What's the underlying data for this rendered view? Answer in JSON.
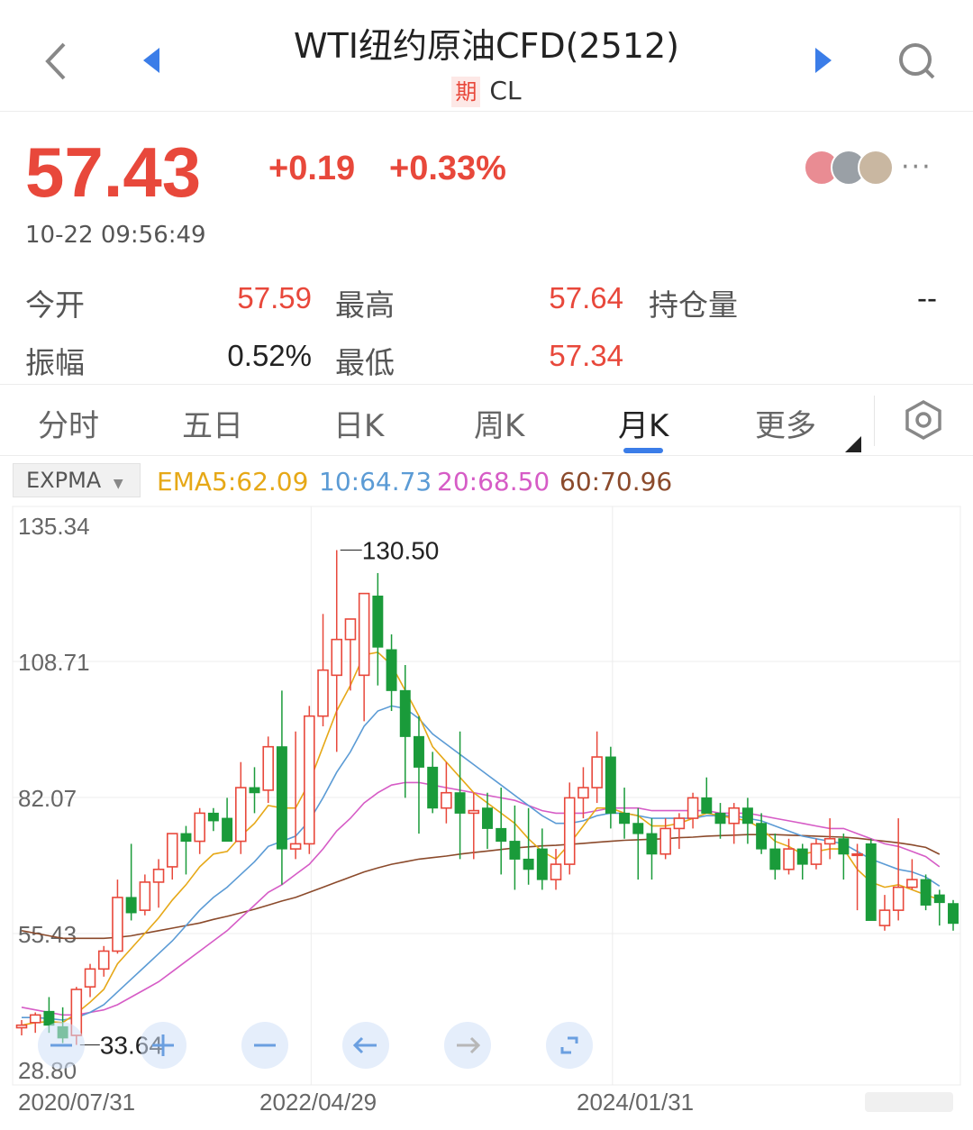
{
  "header": {
    "title": "WTI纽约原油CFD(2512)",
    "badge": "期",
    "symbol": "CL",
    "icons": [
      "back-icon",
      "prev-triangle-icon",
      "next-triangle-icon",
      "search-icon"
    ]
  },
  "quote": {
    "price": "57.43",
    "change": "+0.19",
    "change_pct": "+0.33%",
    "time": "10-22 09:56:49",
    "more": "···"
  },
  "stats": {
    "open_label": "今开",
    "open": "57.59",
    "high_label": "最高",
    "high": "57.64",
    "oi_label": "持仓量",
    "oi": "--",
    "amp_label": "振幅",
    "amp": "0.52%",
    "low_label": "最低",
    "low": "57.34"
  },
  "tabs": [
    {
      "label": "分时"
    },
    {
      "label": "五日"
    },
    {
      "label": "日K"
    },
    {
      "label": "周K"
    },
    {
      "label": "月K"
    },
    {
      "label": "更多"
    }
  ],
  "active_tab": "月K",
  "indicator": {
    "name": "EXPMA",
    "ema5": "EMA5:62.09",
    "ema10": "10:64.73",
    "ema20": "20:68.50",
    "ema60": "60:70.96"
  },
  "colors": {
    "up": "#e8483b",
    "down": "#1a9b3a",
    "ema5": "#e6a817",
    "ema10": "#5b9bd5",
    "ema20": "#d65cc6",
    "ema60": "#8b4a2b",
    "accent": "#3b7de8"
  },
  "chart_data": {
    "type": "candlestick",
    "y_tick_labels": [
      "135.34",
      "108.71",
      "82.07",
      "55.43",
      "28.80"
    ],
    "ylim": [
      28.8,
      135.34
    ],
    "x_tick_labels": [
      "2020/07/31",
      "2022/04/29",
      "2024/01/31"
    ],
    "max_label": "130.50",
    "min_label": "33.64",
    "max_value": 130.5,
    "min_value": 33.64,
    "candles": [
      {
        "o": 37,
        "h": 38.5,
        "l": 35.5,
        "c": 37.5
      },
      {
        "o": 38,
        "h": 40,
        "l": 36,
        "c": 39.5
      },
      {
        "o": 40.2,
        "h": 43,
        "l": 36,
        "c": 37.5
      },
      {
        "o": 37.2,
        "h": 41,
        "l": 34,
        "c": 35
      },
      {
        "o": 35.5,
        "h": 45,
        "l": 33.64,
        "c": 44.5
      },
      {
        "o": 45,
        "h": 49.5,
        "l": 43,
        "c": 48.5
      },
      {
        "o": 48.5,
        "h": 53,
        "l": 47,
        "c": 52
      },
      {
        "o": 52,
        "h": 66,
        "l": 51.5,
        "c": 62.5
      },
      {
        "o": 62.5,
        "h": 73,
        "l": 58,
        "c": 59.5
      },
      {
        "o": 60,
        "h": 67,
        "l": 59,
        "c": 65.5
      },
      {
        "o": 65.5,
        "h": 70,
        "l": 60.5,
        "c": 68
      },
      {
        "o": 68.5,
        "h": 74,
        "l": 66,
        "c": 75
      },
      {
        "o": 75,
        "h": 76.5,
        "l": 67,
        "c": 73.5
      },
      {
        "o": 73.5,
        "h": 80,
        "l": 71,
        "c": 79
      },
      {
        "o": 79,
        "h": 80,
        "l": 75.5,
        "c": 77.5
      },
      {
        "o": 78,
        "h": 82,
        "l": 74,
        "c": 73.5
      },
      {
        "o": 73.5,
        "h": 89,
        "l": 71,
        "c": 84
      },
      {
        "o": 84,
        "h": 88,
        "l": 79,
        "c": 83
      },
      {
        "o": 83.5,
        "h": 94,
        "l": 81,
        "c": 92
      },
      {
        "o": 92,
        "h": 103,
        "l": 65,
        "c": 72
      },
      {
        "o": 72,
        "h": 95,
        "l": 70,
        "c": 73
      },
      {
        "o": 73,
        "h": 100,
        "l": 71,
        "c": 98
      },
      {
        "o": 98,
        "h": 118,
        "l": 96,
        "c": 107
      },
      {
        "o": 106,
        "h": 130.5,
        "l": 91,
        "c": 113
      },
      {
        "o": 113,
        "h": 115,
        "l": 103,
        "c": 117
      },
      {
        "o": 106,
        "h": 120,
        "l": 97,
        "c": 122
      },
      {
        "o": 121.5,
        "h": 126,
        "l": 104,
        "c": 111.5
      },
      {
        "o": 111,
        "h": 114,
        "l": 99,
        "c": 103
      },
      {
        "o": 103,
        "h": 108,
        "l": 82,
        "c": 94
      },
      {
        "o": 94,
        "h": 98,
        "l": 75,
        "c": 88
      },
      {
        "o": 88,
        "h": 91,
        "l": 79,
        "c": 80
      },
      {
        "o": 80,
        "h": 89,
        "l": 77,
        "c": 83
      },
      {
        "o": 83,
        "h": 95,
        "l": 70,
        "c": 79
      },
      {
        "o": 79,
        "h": 83,
        "l": 70,
        "c": 79.5
      },
      {
        "o": 80,
        "h": 83,
        "l": 72,
        "c": 76
      },
      {
        "o": 76,
        "h": 84,
        "l": 67,
        "c": 73.5
      },
      {
        "o": 73.5,
        "h": 80.5,
        "l": 64,
        "c": 70
      },
      {
        "o": 70,
        "h": 80,
        "l": 65,
        "c": 68
      },
      {
        "o": 72,
        "h": 76,
        "l": 64,
        "c": 66
      },
      {
        "o": 66,
        "h": 72,
        "l": 64,
        "c": 69
      },
      {
        "o": 69,
        "h": 85,
        "l": 67,
        "c": 82
      },
      {
        "o": 82,
        "h": 88,
        "l": 78,
        "c": 84
      },
      {
        "o": 84,
        "h": 95,
        "l": 81,
        "c": 90
      },
      {
        "o": 90,
        "h": 92,
        "l": 76,
        "c": 79
      },
      {
        "o": 79,
        "h": 84,
        "l": 74,
        "c": 77
      },
      {
        "o": 77,
        "h": 80,
        "l": 66,
        "c": 75
      },
      {
        "o": 75,
        "h": 78,
        "l": 66,
        "c": 71
      },
      {
        "o": 71,
        "h": 78,
        "l": 70,
        "c": 76
      },
      {
        "o": 76,
        "h": 79,
        "l": 72,
        "c": 78
      },
      {
        "o": 78,
        "h": 83,
        "l": 76,
        "c": 82
      },
      {
        "o": 82,
        "h": 86,
        "l": 80,
        "c": 79
      },
      {
        "o": 79,
        "h": 81,
        "l": 74,
        "c": 77
      },
      {
        "o": 77,
        "h": 81,
        "l": 73,
        "c": 80
      },
      {
        "o": 80,
        "h": 82,
        "l": 73,
        "c": 77
      },
      {
        "o": 77,
        "h": 79,
        "l": 71,
        "c": 72
      },
      {
        "o": 72,
        "h": 75,
        "l": 66,
        "c": 68
      },
      {
        "o": 68,
        "h": 74,
        "l": 67,
        "c": 72
      },
      {
        "o": 72,
        "h": 73,
        "l": 66,
        "c": 69
      },
      {
        "o": 69,
        "h": 74,
        "l": 68,
        "c": 73
      },
      {
        "o": 73,
        "h": 78,
        "l": 70,
        "c": 74
      },
      {
        "o": 74,
        "h": 75,
        "l": 66,
        "c": 71
      },
      {
        "o": 71,
        "h": 73,
        "l": 60,
        "c": 71
      },
      {
        "o": 73,
        "h": 74,
        "l": 58,
        "c": 58
      },
      {
        "o": 57,
        "h": 63,
        "l": 56,
        "c": 60
      },
      {
        "o": 60,
        "h": 78,
        "l": 58,
        "c": 64.5
      },
      {
        "o": 64.5,
        "h": 70,
        "l": 64,
        "c": 66
      },
      {
        "o": 66,
        "h": 67,
        "l": 60,
        "c": 61
      },
      {
        "o": 63,
        "h": 64,
        "l": 57,
        "c": 61.5
      },
      {
        "o": 61.3,
        "h": 62,
        "l": 56,
        "c": 57.43
      }
    ],
    "ema5": [
      37.5,
      38,
      38.2,
      38,
      39.8,
      42,
      44.5,
      49.5,
      52.5,
      55.5,
      58.5,
      62,
      65,
      68.5,
      71,
      71.5,
      74.5,
      77,
      80.5,
      80,
      80,
      85,
      92,
      99,
      104,
      110,
      110.5,
      108,
      103,
      98,
      92,
      89,
      86,
      83,
      81,
      79,
      77,
      74,
      71.5,
      70,
      73,
      76.5,
      80,
      80,
      79,
      78.5,
      76.5,
      76.5,
      77,
      78,
      79,
      78.5,
      78,
      77.5,
      76,
      73.5,
      72.5,
      71,
      71.5,
      72,
      72,
      68,
      65.5,
      64.5,
      65,
      64,
      63,
      62.09
    ],
    "ema10": [
      39,
      39,
      38.8,
      38.5,
      39,
      40,
      41.5,
      44,
      46.5,
      49,
      51.5,
      54,
      57,
      60,
      62.5,
      64.5,
      67,
      69.5,
      72.5,
      73.5,
      74.5,
      77.5,
      82,
      87,
      91,
      96,
      99,
      100,
      99.5,
      97.5,
      94.5,
      92.5,
      90.5,
      88.5,
      86.5,
      84.5,
      82.5,
      80.5,
      78.5,
      77,
      77,
      77.5,
      78.5,
      79,
      79,
      78.5,
      78,
      78,
      78,
      78,
      78.5,
      78.5,
      78.5,
      78,
      77.5,
      76.5,
      75.5,
      74.5,
      74,
      73.5,
      73,
      71.5,
      70,
      69,
      68,
      67.5,
      66.5,
      64.73
    ],
    "ema20": [
      41,
      40.5,
      40,
      39.5,
      39.5,
      40,
      40.5,
      41.5,
      43,
      44.5,
      46,
      48,
      50,
      52,
      54,
      56,
      58.5,
      61,
      63.5,
      65,
      67,
      69,
      72,
      75.5,
      78,
      81,
      83,
      84.5,
      85,
      85,
      84.5,
      84,
      83.5,
      83,
      82.5,
      82,
      81.5,
      80.5,
      79.5,
      79,
      79,
      79,
      79.5,
      80,
      80,
      80,
      79.5,
      79.5,
      79.5,
      79.5,
      79.5,
      79,
      79,
      79,
      78.5,
      78,
      77.5,
      77,
      76.5,
      76,
      76,
      75,
      74,
      73,
      72.5,
      71.5,
      70.5,
      68.5
    ],
    "ema60": [
      56,
      55.5,
      55,
      54.5,
      54.5,
      54.5,
      54.5,
      54.7,
      55,
      55.5,
      56,
      56.5,
      57,
      57.5,
      58.2,
      58.8,
      59.5,
      60.2,
      61,
      61.8,
      62.5,
      63.5,
      64.5,
      65.5,
      66.5,
      67.5,
      68.3,
      69,
      69.5,
      70,
      70.3,
      70.6,
      71,
      71.3,
      71.6,
      71.9,
      72.2,
      72.4,
      72.6,
      72.7,
      72.9,
      73.1,
      73.3,
      73.5,
      73.7,
      73.8,
      73.9,
      74,
      74.2,
      74.3,
      74.5,
      74.6,
      74.7,
      74.8,
      74.8,
      74.8,
      74.7,
      74.6,
      74.5,
      74.4,
      74.3,
      74.1,
      73.8,
      73.5,
      73.2,
      72.8,
      72.3,
      70.96
    ]
  },
  "chart_controls": [
    {
      "name": "zoom-out-icon"
    },
    {
      "name": "zoom-in-icon"
    },
    {
      "name": "minus-icon"
    },
    {
      "name": "left-arrow-icon"
    },
    {
      "name": "right-arrow-icon"
    },
    {
      "name": "reset-icon"
    }
  ]
}
